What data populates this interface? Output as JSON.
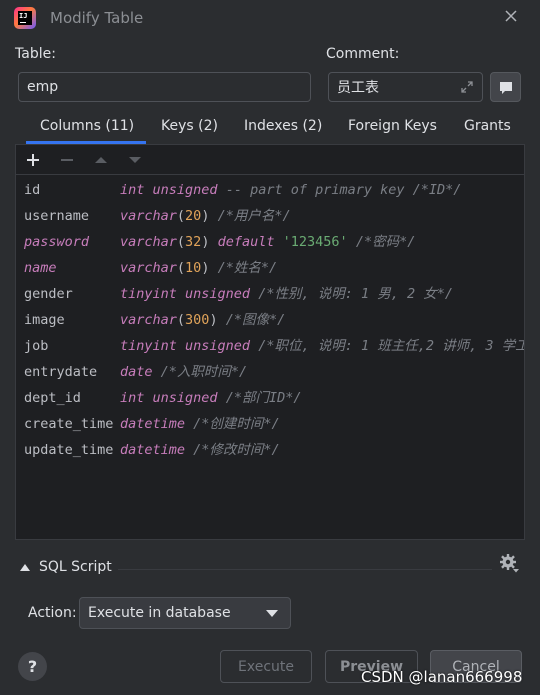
{
  "window": {
    "title": "Modify Table"
  },
  "form": {
    "table_label": "Table:",
    "table_value": "emp",
    "comment_label": "Comment:",
    "comment_value": "员工表"
  },
  "tabs": [
    {
      "label": "Columns (11)",
      "active": true
    },
    {
      "label": "Keys (2)"
    },
    {
      "label": "Indexes (2)"
    },
    {
      "label": "Foreign Keys"
    },
    {
      "label": "Grants"
    }
  ],
  "columns": [
    {
      "name": "id",
      "type": "int unsigned",
      "comment": "-- part of primary key /*ID*/"
    },
    {
      "name": "username",
      "type": "varchar",
      "size": "20",
      "comment": "/*用户名*/"
    },
    {
      "name": "password",
      "type": "varchar",
      "size": "32",
      "default_kw": "default",
      "default_value": "'123456'",
      "comment": "/*密码*/"
    },
    {
      "name": "name",
      "type": "varchar",
      "size": "10",
      "comment": "/*姓名*/"
    },
    {
      "name": "gender",
      "type": "tinyint unsigned",
      "comment": "/*性别, 说明: 1 男, 2 女*/"
    },
    {
      "name": "image",
      "type": "varchar",
      "size": "300",
      "comment": "/*图像*/"
    },
    {
      "name": "job",
      "type": "tinyint unsigned",
      "comment": "/*职位, 说明: 1 班主任,2 讲师, 3 学工"
    },
    {
      "name": "entrydate",
      "type": "date",
      "comment": "/*入职时间*/"
    },
    {
      "name": "dept_id",
      "type": "int unsigned",
      "comment": "/*部门ID*/"
    },
    {
      "name": "create_time",
      "type": "datetime",
      "comment": "/*创建时间*/"
    },
    {
      "name": "update_time",
      "type": "datetime",
      "comment": "/*修改时间*/"
    }
  ],
  "sql_section": {
    "label": "SQL Script"
  },
  "action": {
    "label": "Action:",
    "selected": "Execute in database"
  },
  "buttons": {
    "execute": "Execute",
    "preview": "Preview",
    "cancel": "Cancel"
  },
  "watermark": "CSDN @lanan666998",
  "colors": {
    "accent": "#3574f0",
    "keyword": "#c77dbb",
    "string": "#6aab73",
    "comment": "#7a7e85",
    "number": "#e0a35a"
  },
  "icons": [
    "app-logo-icon",
    "close-icon",
    "expand-icon",
    "comment-icon",
    "add-icon",
    "remove-icon",
    "move-up-icon",
    "move-down-icon",
    "collapse-arrow-icon",
    "gear-icon",
    "help-icon",
    "dropdown-caret-icon"
  ]
}
